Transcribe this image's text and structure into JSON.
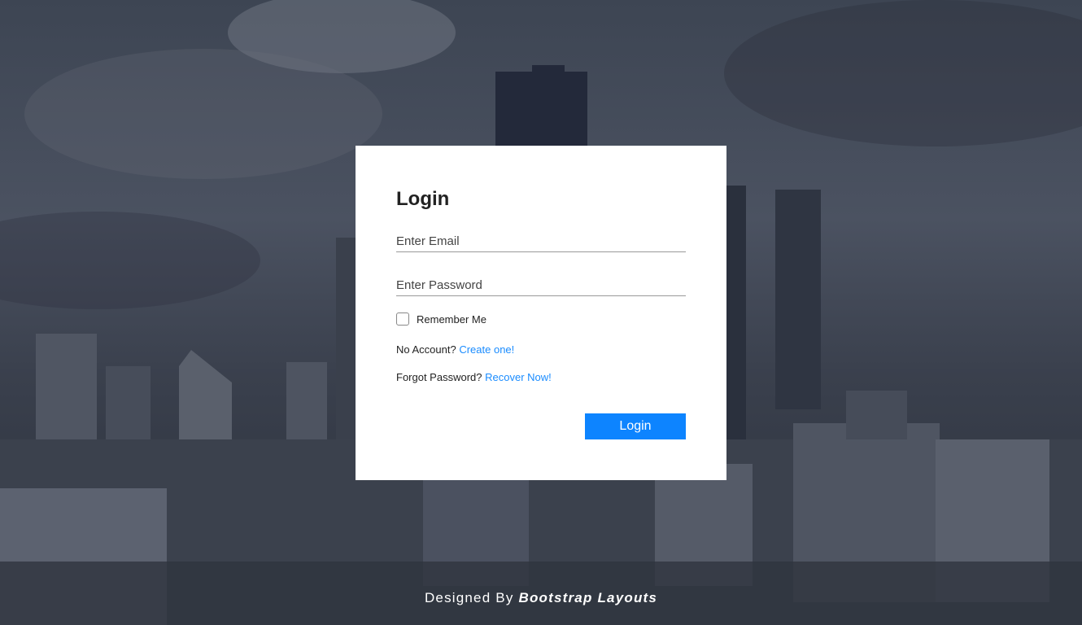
{
  "login": {
    "title": "Login",
    "email_placeholder": "Enter Email",
    "password_placeholder": "Enter Password",
    "remember_label": "Remember Me",
    "no_account_text": "No Account?",
    "create_link": "Create one!",
    "forgot_text": "Forgot Password?",
    "recover_link": "Recover Now!",
    "button_label": "Login"
  },
  "footer": {
    "prefix": "Designed By",
    "brand": "Bootstrap Layouts"
  },
  "colors": {
    "accent": "#0d84ff",
    "link": "#1a8cff",
    "card": "#ffffff"
  }
}
